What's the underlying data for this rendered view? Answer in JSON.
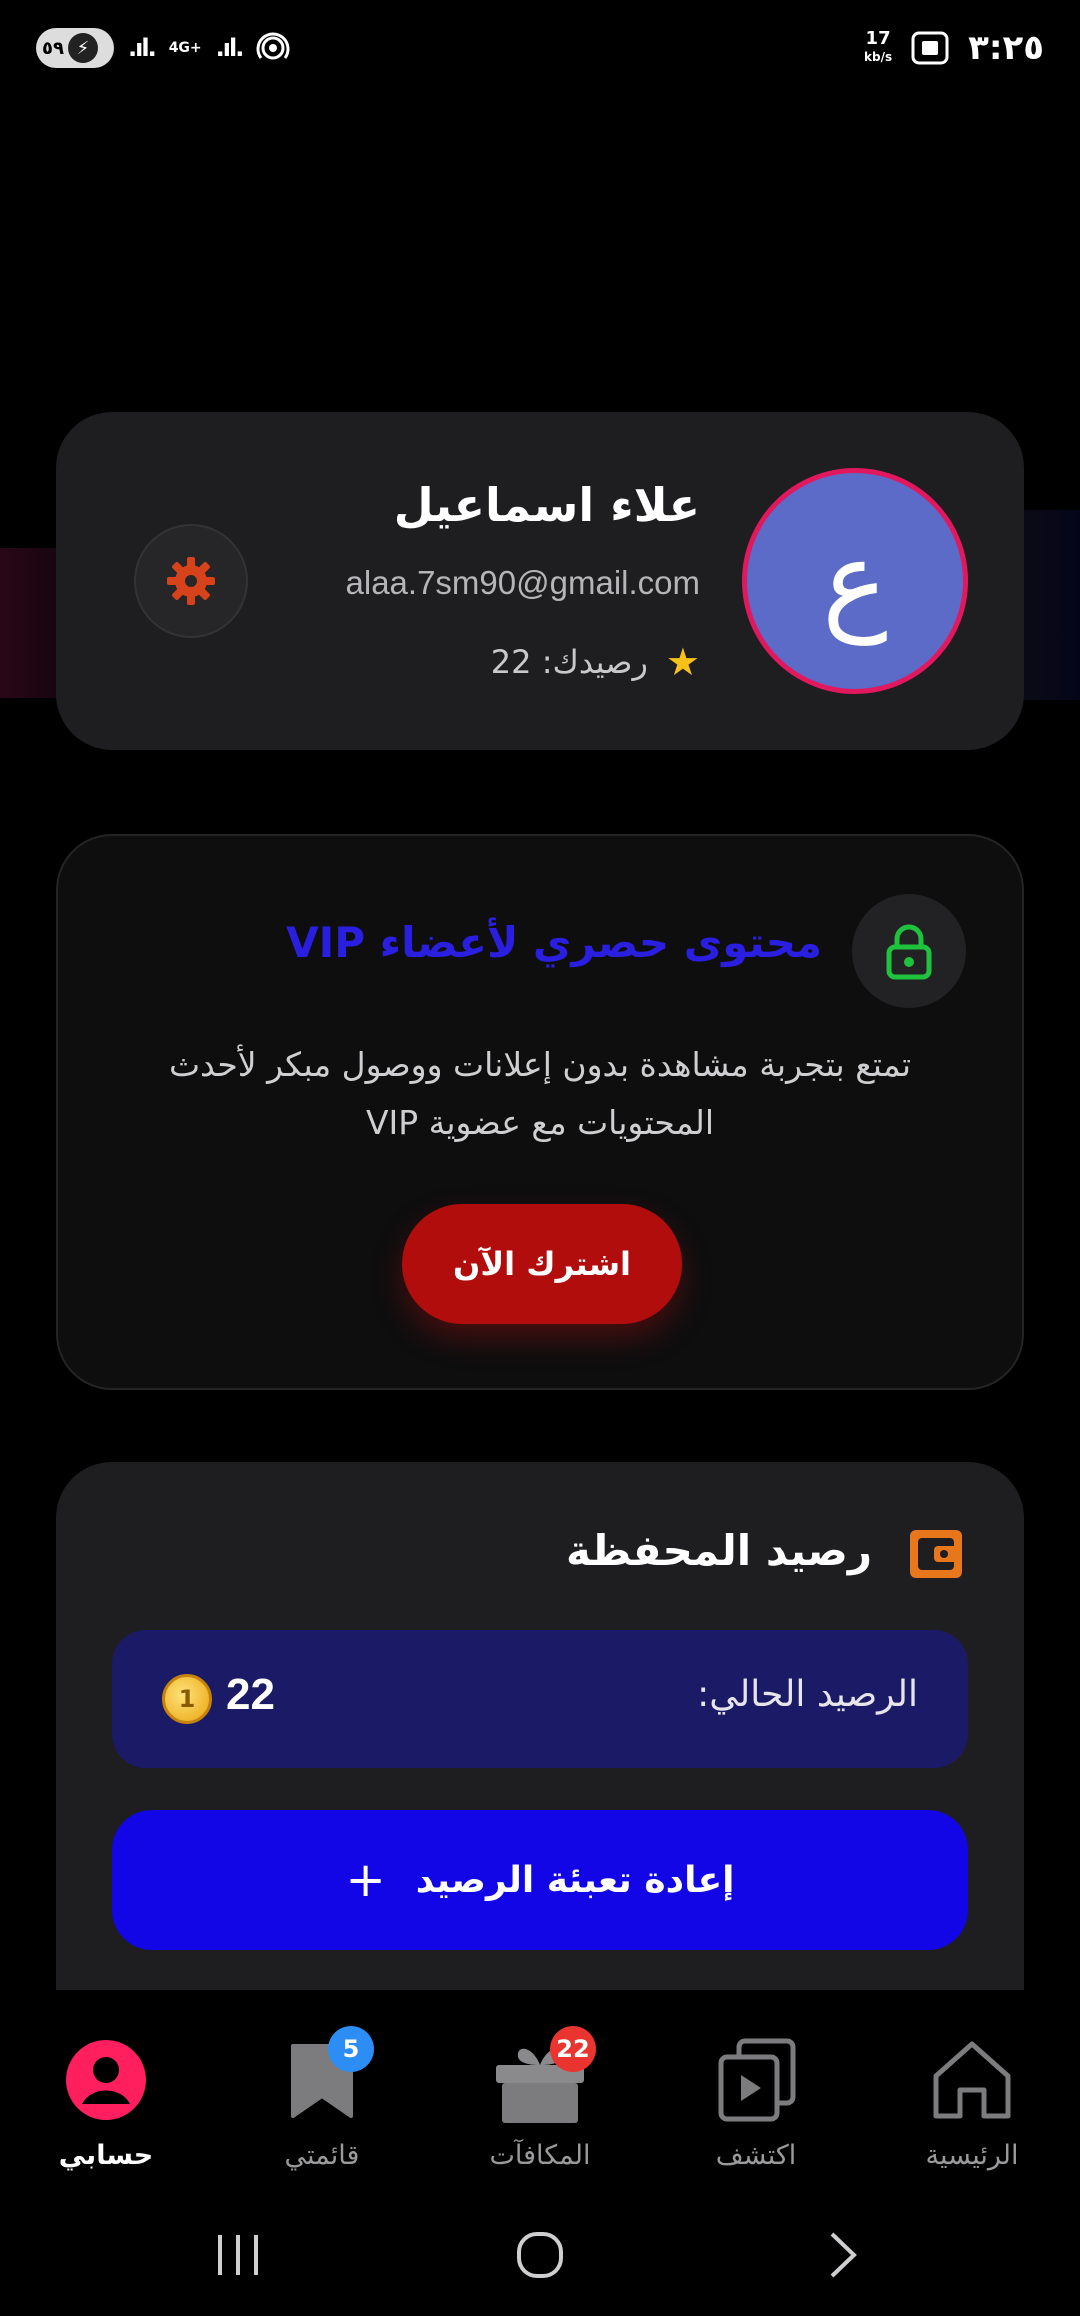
{
  "status_bar": {
    "battery_level": "٥٩",
    "network": "4G+",
    "speed_value": "17",
    "speed_unit": "kb/s",
    "time": "٣:٢٥"
  },
  "profile": {
    "avatar_letter": "ع",
    "name": "علاء اسماعيل",
    "email": "alaa.7sm90@gmail.com",
    "balance_label": "رصيدك: 22",
    "avatar_bg": "#5b6bc7",
    "avatar_ring": "#e2185f"
  },
  "vip": {
    "title": "محتوى حصري لأعضاء VIP",
    "description": "تمتع بتجربة مشاهدة بدون إعلانات ووصول مبكر لأحدث المحتويات مع عضوية VIP",
    "subscribe_label": "اشترك الآن",
    "title_color": "#2a1fe0"
  },
  "wallet": {
    "title": "رصيد المحفظة",
    "current_balance_label": "الرصيد الحالي:",
    "current_balance_value": "22",
    "refill_label": "إعادة تعبئة الرصيد"
  },
  "bottom_nav": {
    "items": [
      {
        "label": "حسابي",
        "active": true
      },
      {
        "label": "قائمتي",
        "badge": "5"
      },
      {
        "label": "المكافآت",
        "badge": "22"
      },
      {
        "label": "اكتشف"
      },
      {
        "label": "الرئيسية"
      }
    ]
  }
}
